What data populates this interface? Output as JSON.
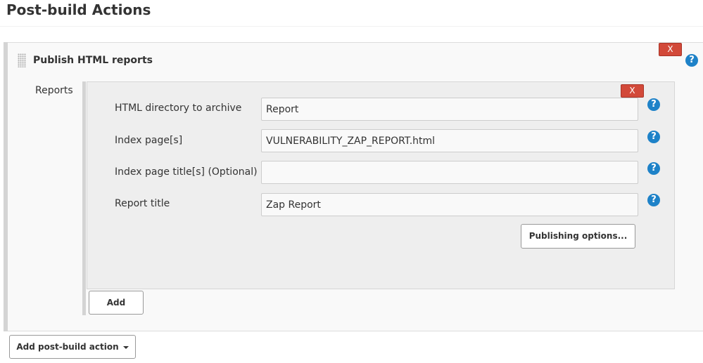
{
  "section": {
    "title": "Post-build Actions"
  },
  "publisher": {
    "title": "Publish HTML reports",
    "delete_label": "X"
  },
  "reports": {
    "label": "Reports",
    "delete_label": "X",
    "fields": [
      {
        "label": "HTML directory to archive",
        "value": "Report"
      },
      {
        "label": "Index page[s]",
        "value": "VULNERABILITY_ZAP_REPORT.html"
      },
      {
        "label": "Index page title[s] (Optional)",
        "value": ""
      },
      {
        "label": "Report title",
        "value": "Zap Report"
      }
    ],
    "publishing_options_label": "Publishing options...",
    "add_label": "Add"
  },
  "footer": {
    "add_post_build_action_label": "Add post-build action"
  },
  "icons": {
    "help": "help-icon",
    "drag": "drag-handle-icon",
    "dropdown": "caret-down-icon"
  },
  "colors": {
    "delete": "#d24939",
    "help": "#1e82c8"
  }
}
